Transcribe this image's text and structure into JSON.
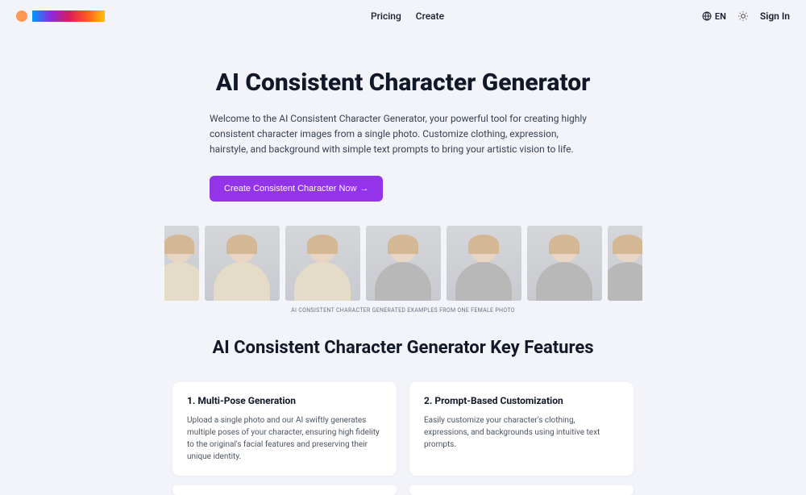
{
  "header": {
    "nav": {
      "pricing": "Pricing",
      "create": "Create"
    },
    "lang": "EN",
    "signin": "Sign In"
  },
  "hero": {
    "title": "AI Consistent Character Generator",
    "description": "Welcome to the AI Consistent Character Generator, your powerful tool for creating highly consistent character images from a single photo. Customize clothing, expression, hairstyle, and background with simple text prompts to bring your artistic vision to life.",
    "cta": "Create Consistent Character Now"
  },
  "gallery": {
    "caption": "AI CONSISTENT CHARACTER GENERATED EXAMPLES FROM ONE FEMALE PHOTO"
  },
  "features": {
    "title": "AI Consistent Character Generator Key Features",
    "items": [
      {
        "title": "1. Multi-Pose Generation",
        "desc": "Upload a single photo and our AI swiftly generates multiple poses of your character, ensuring high fidelity to the original's facial features and preserving their unique identity."
      },
      {
        "title": "2. Prompt-Based Customization",
        "desc": "Easily customize your character's clothing, expressions, and backgrounds using intuitive text prompts."
      }
    ]
  }
}
